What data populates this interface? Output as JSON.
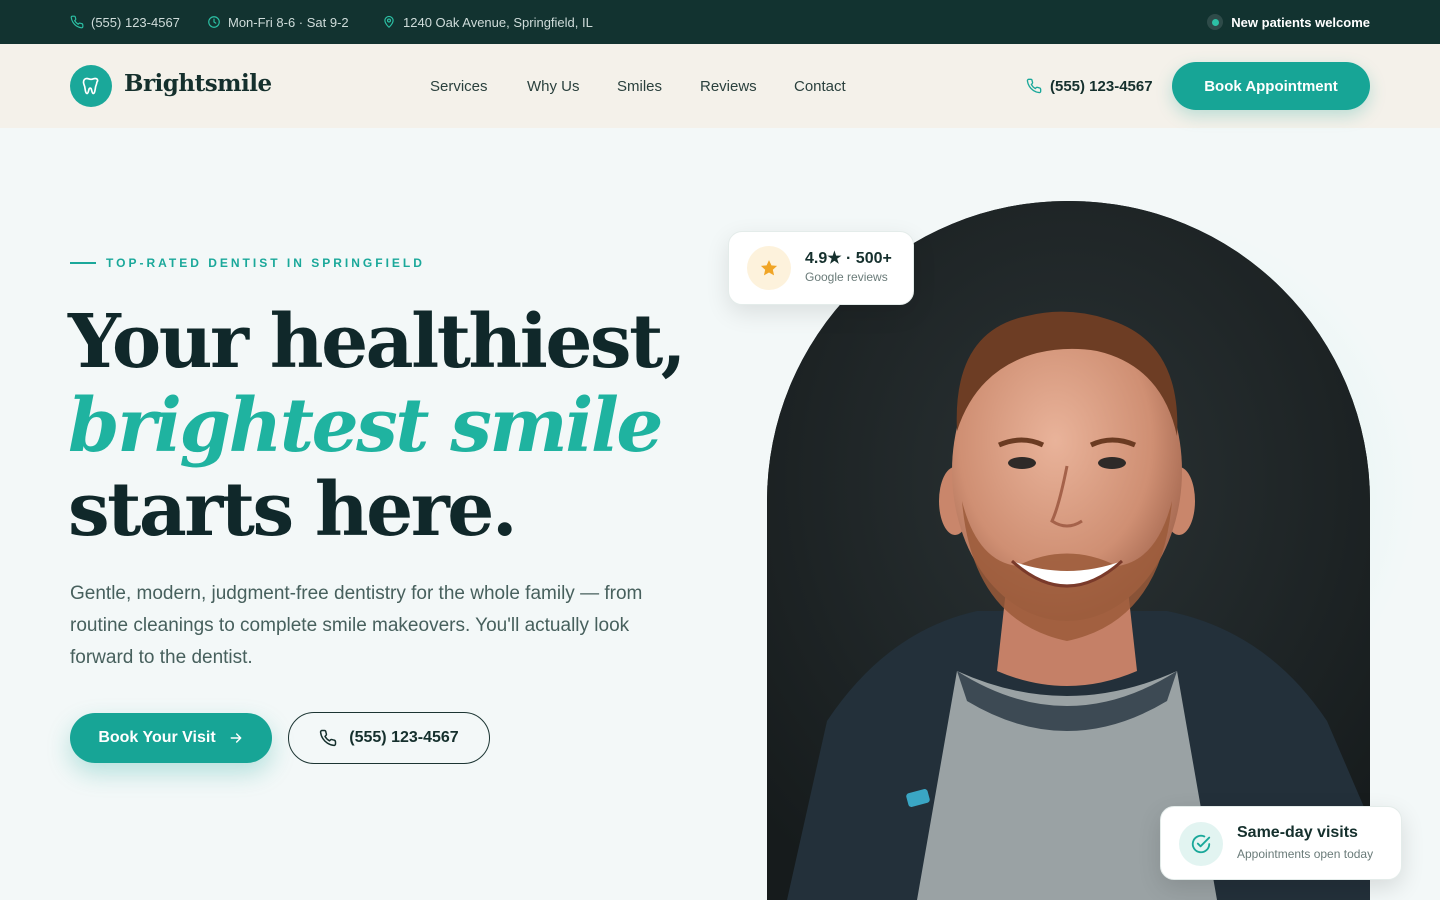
{
  "topbar": {
    "phone": "(555) 123-4567",
    "hours": "Mon-Fri 8-6 · Sat 9-2",
    "address": "1240 Oak Avenue, Springfield, IL",
    "badge": "New patients welcome"
  },
  "nav": {
    "logo_text": "Brightsmile",
    "links": [
      "Services",
      "Why Us",
      "Smiles",
      "Reviews",
      "Contact"
    ],
    "phone": "(555) 123-4567",
    "book_label": "Book Appointment"
  },
  "hero": {
    "eyebrow": "TOP-RATED DENTIST IN SPRINGFIELD",
    "headline_line1": "Your healthiest,",
    "headline_line2": "brightest smile",
    "headline_line3": "starts here.",
    "subtext": "Gentle, modern, judgment-free dentistry for the whole family — from routine cleanings to complete smile makeovers. You'll actually look forward to the dentist.",
    "cta_primary": "Book Your Visit",
    "cta_secondary": "(555) 123-4567"
  },
  "rating_card": {
    "main": "4.9★ · 500+",
    "sub": "Google reviews"
  },
  "sameday_card": {
    "title": "Same-day visits",
    "sub": "Appointments open today"
  },
  "icons": {
    "phone": "phone-icon",
    "clock": "clock-icon",
    "location": "location-pin-icon",
    "tooth": "tooth-icon",
    "arrow": "arrow-right-icon",
    "star": "star-icon",
    "check": "check-circle-icon"
  },
  "colors": {
    "brand_teal": "#17a596",
    "dark_green": "#123330",
    "accent_text": "#1fb3a0",
    "star_gold": "#f0a526",
    "nav_bg": "#f4f1ea"
  }
}
